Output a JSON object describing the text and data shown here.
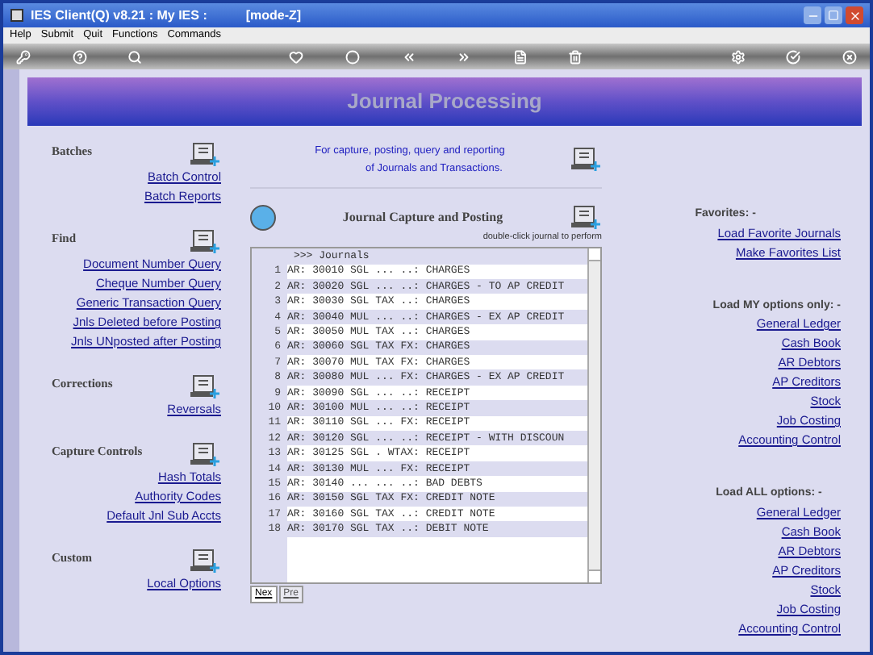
{
  "window": {
    "title": "IES Client(Q) v8.21 : My IES :",
    "mode": "[mode-Z]"
  },
  "menu": [
    "Help",
    "Submit",
    "Quit",
    "Functions",
    "Commands"
  ],
  "banner": {
    "title": "Journal Processing"
  },
  "left_sections": [
    {
      "title": "Batches",
      "links": [
        "Batch Control",
        "Batch Reports"
      ]
    },
    {
      "title": "Find",
      "links": [
        "Document Number Query",
        "Cheque Number Query",
        "Generic Transaction Query",
        "Jnls Deleted before Posting",
        "Jnls UNposted after Posting"
      ]
    },
    {
      "title": "Corrections",
      "links": [
        "Reversals"
      ]
    },
    {
      "title": "Capture Controls",
      "links": [
        "Hash Totals",
        "Authority Codes",
        "Default Jnl Sub Accts"
      ]
    },
    {
      "title": "Custom",
      "links": [
        "Local Options"
      ]
    }
  ],
  "intro": {
    "line_1": "For capture, posting, query and reporting",
    "line_2": "of Journals and Transactions."
  },
  "journals": {
    "title": "Journal Capture and Posting",
    "hint": "double-click journal to perform",
    "header": ">>> Journals",
    "rows": [
      {
        "num": "1",
        "text": "AR: 30010 SGL ... ..: CHARGES"
      },
      {
        "num": "2",
        "text": "AR: 30020 SGL ... ..: CHARGES - TO AP CREDIT"
      },
      {
        "num": "3",
        "text": "AR: 30030 SGL TAX ..: CHARGES"
      },
      {
        "num": "4",
        "text": "AR: 30040 MUL ... ..: CHARGES - EX AP CREDIT"
      },
      {
        "num": "5",
        "text": "AR: 30050 MUL TAX ..: CHARGES"
      },
      {
        "num": "6",
        "text": "AR: 30060 SGL TAX FX: CHARGES"
      },
      {
        "num": "7",
        "text": "AR: 30070 MUL TAX FX: CHARGES"
      },
      {
        "num": "8",
        "text": "AR: 30080 MUL ... FX: CHARGES - EX AP CREDIT"
      },
      {
        "num": "9",
        "text": "AR: 30090 SGL ... ..: RECEIPT"
      },
      {
        "num": "10",
        "text": "AR: 30100 MUL ... ..: RECEIPT"
      },
      {
        "num": "11",
        "text": "AR: 30110 SGL ... FX: RECEIPT"
      },
      {
        "num": "12",
        "text": "AR: 30120 SGL ... ..: RECEIPT - WITH DISCOUN"
      },
      {
        "num": "13",
        "text": "AR: 30125 SGL . WTAX: RECEIPT"
      },
      {
        "num": "14",
        "text": "AR: 30130 MUL ... FX: RECEIPT"
      },
      {
        "num": "15",
        "text": "AR: 30140 ... ... ..: BAD DEBTS"
      },
      {
        "num": "16",
        "text": "AR: 30150 SGL TAX FX: CREDIT NOTE"
      },
      {
        "num": "17",
        "text": "AR: 30160 SGL TAX ..: CREDIT NOTE"
      },
      {
        "num": "18",
        "text": "AR: 30170 SGL TAX ..: DEBIT NOTE"
      }
    ],
    "tabs": [
      {
        "label": "Nex",
        "selected": true
      },
      {
        "label": "Pre",
        "selected": false
      }
    ]
  },
  "right_sections": [
    {
      "title": "Favorites: -",
      "links": [
        "Load Favorite Journals",
        "Make Favorites List"
      ]
    },
    {
      "title": "Load MY options only: -",
      "links": [
        "General Ledger",
        "Cash Book",
        "AR Debtors",
        "AP Creditors",
        "Stock",
        "Job Costing",
        "Accounting Control"
      ]
    },
    {
      "title": "Load ALL options: -",
      "links": [
        "General Ledger",
        "Cash Book",
        "AR Debtors",
        "AP Creditors",
        "Stock",
        "Job Costing",
        "Accounting Control"
      ]
    }
  ]
}
